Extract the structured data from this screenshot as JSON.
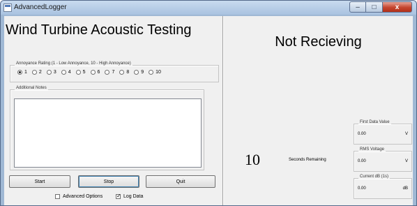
{
  "window": {
    "title": "AdvancedLogger"
  },
  "window_controls": {
    "minimize": "–",
    "maximize": "□",
    "close": "x"
  },
  "app": {
    "heading": "Wind Turbine Acoustic Testing"
  },
  "rating": {
    "legend": "Annoyance Rating (1 - Low Annoyance, 10 - High Annoyance)",
    "selected": "1",
    "options": [
      "1",
      "2",
      "3",
      "4",
      "5",
      "6",
      "7",
      "8",
      "9",
      "10"
    ]
  },
  "notes": {
    "legend": "Additional Notes",
    "value": ""
  },
  "buttons": {
    "start": "Start",
    "stop": "Stop",
    "quit": "Quit"
  },
  "options": {
    "advanced_label": "Advanced Options",
    "advanced_checked": false,
    "log_label": "Log Data",
    "log_checked": true
  },
  "status": {
    "text": "Not Recieving"
  },
  "countdown": {
    "value": "10",
    "label": "Seconds Remaining"
  },
  "readings": [
    {
      "label": "First Data Value",
      "value": "0.00",
      "unit": "V"
    },
    {
      "label": "RMS Voltage",
      "value": "0.00",
      "unit": "V"
    },
    {
      "label": "Current dB  (1s)",
      "value": "0.00",
      "unit": "dB"
    }
  ]
}
